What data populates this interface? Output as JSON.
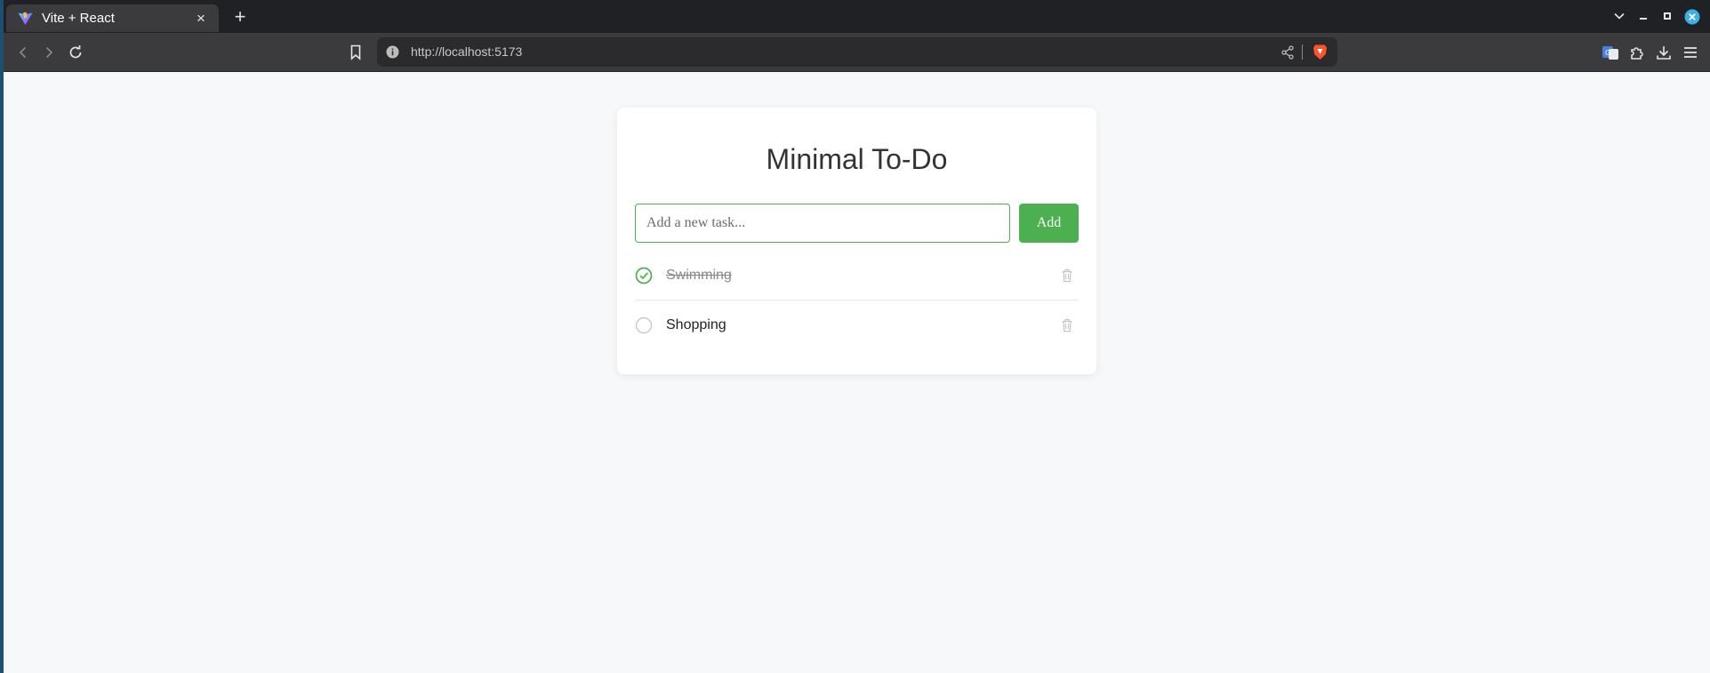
{
  "browser": {
    "tab_title": "Vite + React",
    "tab_close": "×",
    "new_tab": "+",
    "url": "http://localhost:5173"
  },
  "app": {
    "title": "Minimal To-Do",
    "input_placeholder": "Add a new task...",
    "input_value": "",
    "add_label": "Add",
    "tasks": [
      {
        "label": "Swimming",
        "completed": true
      },
      {
        "label": "Shopping",
        "completed": false
      }
    ]
  },
  "colors": {
    "accent": "#4caf50",
    "page_bg": "#f7f8fa",
    "card_bg": "#ffffff",
    "browser_chrome": "#3b3b3d",
    "tab_strip": "#202124"
  },
  "icons": {
    "tab_favicon": "vite-logo-icon",
    "back": "back-arrow-icon",
    "forward": "forward-arrow-icon",
    "reload": "reload-icon",
    "bookmark": "bookmark-icon",
    "site_info": "info-icon",
    "share": "share-icon",
    "brave": "brave-shield-icon",
    "translate": "translate-icon",
    "extensions": "puzzle-icon",
    "downloads": "download-icon",
    "menu": "hamburger-menu-icon",
    "task_done": "check-circle-icon",
    "task_open": "empty-circle-icon",
    "delete": "trash-icon"
  }
}
